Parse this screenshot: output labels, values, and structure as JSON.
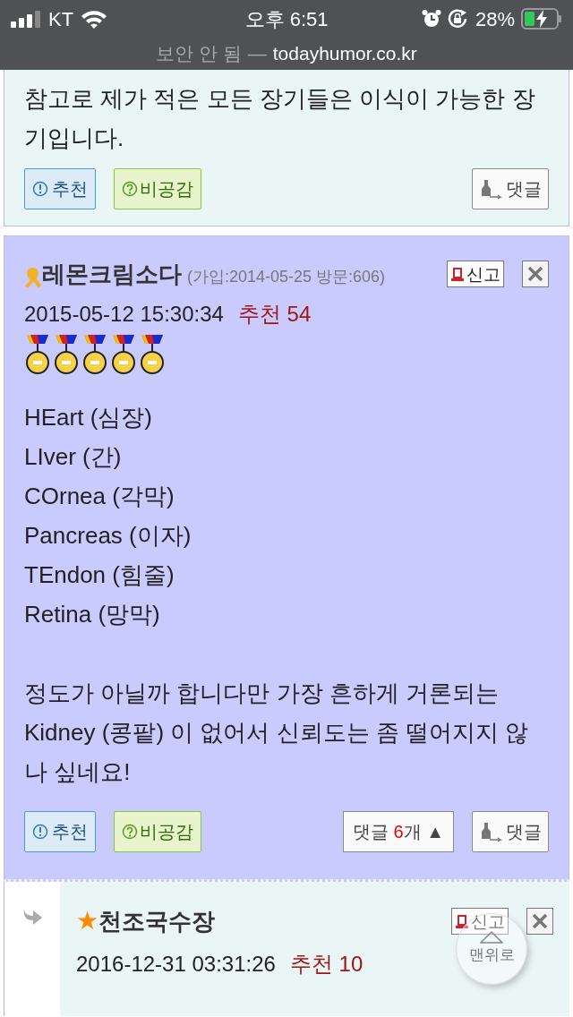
{
  "status_bar": {
    "carrier": "KT",
    "time": "오후 6:51",
    "battery": "28%",
    "charging": true
  },
  "url_bar": {
    "security": "보안 안 됨",
    "separator": "—",
    "domain": "todayhumor.co.kr"
  },
  "comments": [
    {
      "kind": "partial",
      "body": "참고로 제가 적은 모든 장기들은 이식이 가능한 장기입니다.",
      "recommend": "추천",
      "disagree": "비공감",
      "reply": "댓글"
    },
    {
      "kind": "full",
      "ribbon": true,
      "author": "레몬크림소다",
      "meta": "(가입:2014-05-25 방문:606)",
      "report": "신고",
      "date": "2015-05-12 15:30:34",
      "score": "추천 54",
      "medals": [
        {
          "kind": "medal"
        },
        {
          "kind": "medal"
        },
        {
          "kind": "medal"
        },
        {
          "kind": "medal"
        },
        {
          "kind": "medal"
        }
      ],
      "lines": [
        "HEart (심장)",
        "LIver (간)",
        "COrnea (각막)",
        "Pancreas (이자)",
        "TEndon (힘줄)",
        "Retina (망막)"
      ],
      "paragraph": "정도가 아닐까 합니다만 가장 흔하게 거론되는 Kidney (콩팥) 이 없어서 신뢰도는 좀 떨어지지 않나 싶네요!",
      "recommend": "추천",
      "disagree": "비공감",
      "toggle": {
        "prefix": "댓글 ",
        "count": "6",
        "suffix": "개 ",
        "arrow": "▲"
      },
      "reply": "댓글"
    },
    {
      "kind": "reply",
      "star": "★",
      "author": "천조국수장",
      "report": "신고",
      "date": "2016-12-31 03:31:26",
      "score": "추천 10"
    }
  ],
  "scroll_top": {
    "label": "맨위로"
  }
}
